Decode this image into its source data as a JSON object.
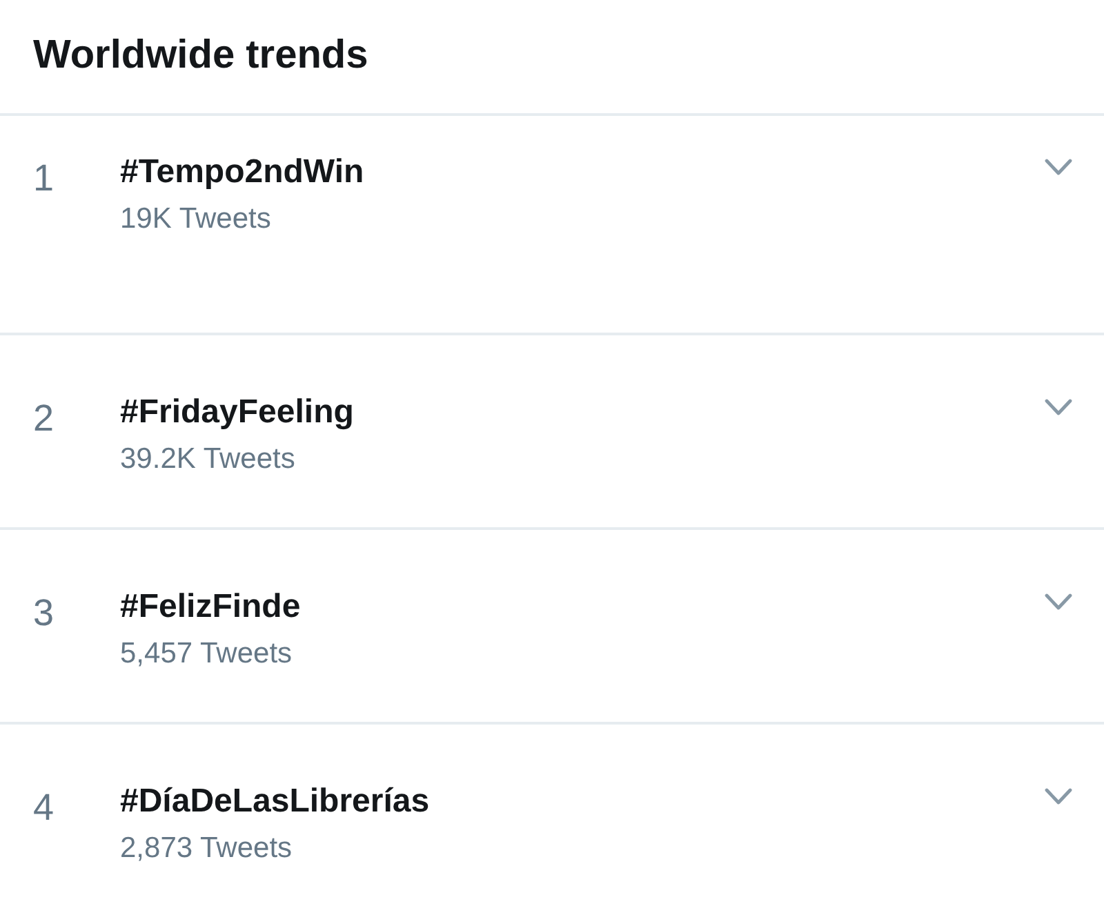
{
  "header": {
    "title": "Worldwide trends"
  },
  "trends": [
    {
      "rank": "1",
      "name": "#Tempo2ndWin",
      "count": "19K Tweets"
    },
    {
      "rank": "2",
      "name": "#FridayFeeling",
      "count": "39.2K Tweets"
    },
    {
      "rank": "3",
      "name": "#FelizFinde",
      "count": "5,457 Tweets"
    },
    {
      "rank": "4",
      "name": "#DíaDeLasLibrerías",
      "count": "2,873 Tweets"
    }
  ]
}
